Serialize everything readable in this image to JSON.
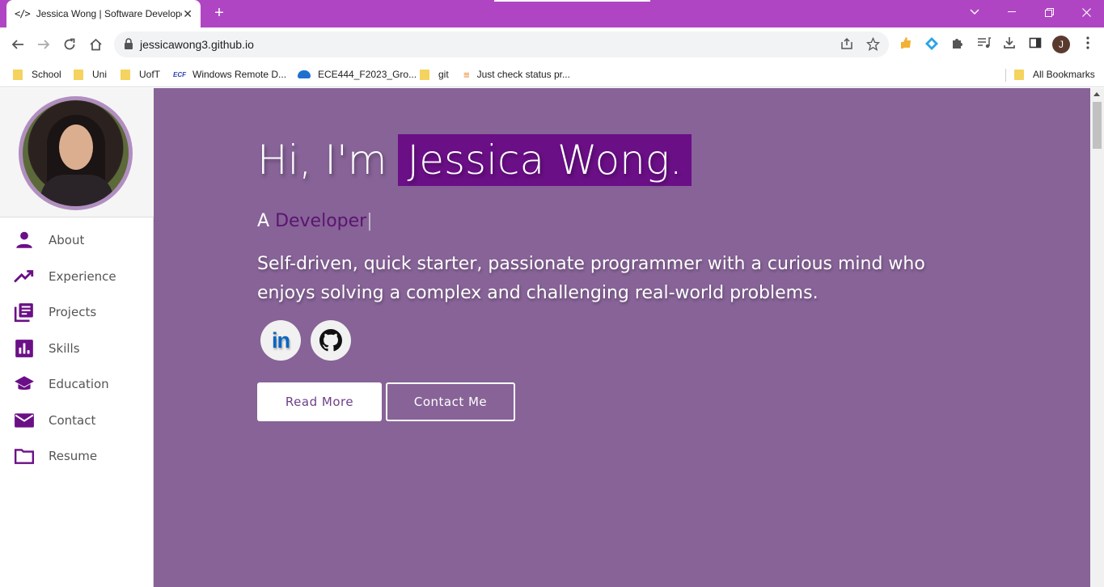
{
  "browser": {
    "tab_favicon": "</>",
    "tab_title": "Jessica Wong | Software Developer",
    "tab_close": "✕",
    "new_tab": "+",
    "url": "jessicawong3.github.io",
    "avatar_initial": "J",
    "accent_color": "#b045c3"
  },
  "bookmarks": {
    "items": [
      {
        "label": "School",
        "icon": "folder-icon"
      },
      {
        "label": "Uni",
        "icon": "folder-icon"
      },
      {
        "label": "UofT",
        "icon": "folder-icon"
      },
      {
        "label": "Windows Remote D...",
        "icon": "ecf-icon"
      },
      {
        "label": "ECE444_F2023_Gro...",
        "icon": "onedrive-icon"
      },
      {
        "label": "git",
        "icon": "folder-icon"
      },
      {
        "label": "Just check status pr...",
        "icon": "stackoverflow-icon"
      }
    ],
    "all_bookmarks": "All Bookmarks"
  },
  "sidebar": {
    "items": [
      {
        "label": "About",
        "icon": "person-icon"
      },
      {
        "label": "Experience",
        "icon": "trending-up-icon"
      },
      {
        "label": "Projects",
        "icon": "library-books-icon"
      },
      {
        "label": "Skills",
        "icon": "bar-chart-icon"
      },
      {
        "label": "Education",
        "icon": "school-icon"
      },
      {
        "label": "Contact",
        "icon": "mail-icon"
      },
      {
        "label": "Resume",
        "icon": "folder-icon"
      }
    ],
    "icon_color": "#6b0f87"
  },
  "hero": {
    "greeting": "Hi, I'm",
    "name": "Jessica Wong.",
    "role_prefix": "A",
    "role": "Developer",
    "cursor": "|",
    "tagline": "Self-driven, quick starter, passionate programmer with a curious mind who enjoys solving a complex and challenging real-world problems.",
    "linkedin_label": "in",
    "read_more": "Read More",
    "contact_me": "Contact Me",
    "background_color": "#876397",
    "highlight_color": "#6b0f87"
  }
}
